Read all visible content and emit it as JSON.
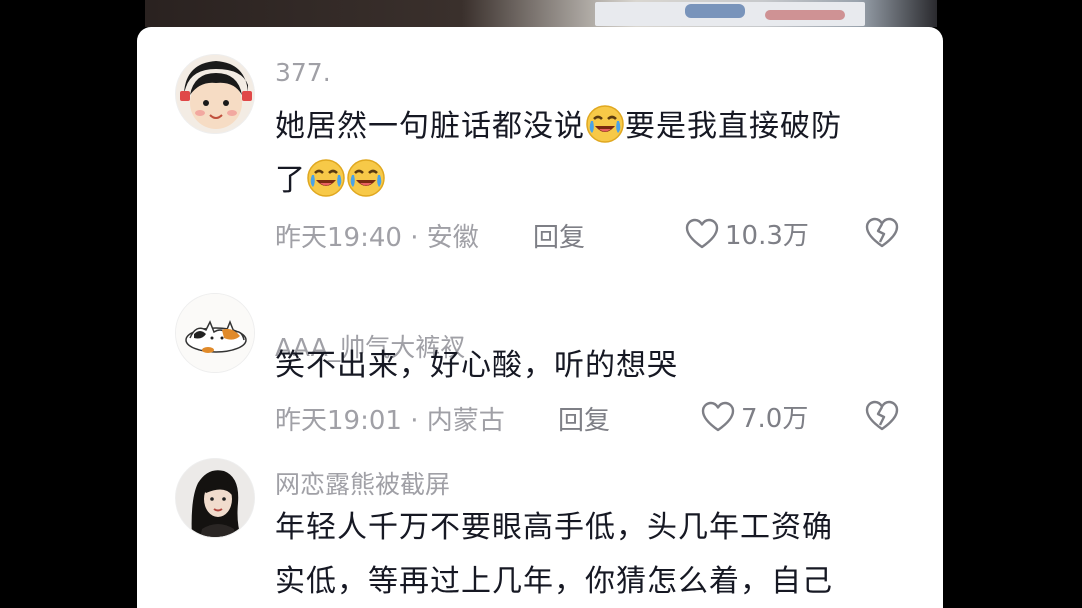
{
  "comments": [
    {
      "username": "377.",
      "text_parts": [
        "她居然一句脏话都没说",
        "要是我直接破防",
        "了"
      ],
      "emoji": "crying-laughing-emoji",
      "time": "昨天19:40",
      "separator": "·",
      "location": "安徽",
      "reply_label": "回复",
      "likes": "10.3万"
    },
    {
      "username": "AAA_帅气大裤衩",
      "text": "笑不出来，好心酸，听的想哭",
      "time": "昨天19:01",
      "separator": "·",
      "location": "内蒙古",
      "reply_label": "回复",
      "likes": "7.0万"
    },
    {
      "username": "网恋露熊被截屏",
      "text_lines": [
        "年轻人千万不要眼高手低，头几年工资确",
        "实低，等再过上几年，你猜怎么着，自己"
      ]
    }
  ],
  "colors": {
    "text": "#161823",
    "meta": "#a0a0a6",
    "action": "#7e7f86",
    "background": "#ffffff"
  },
  "icons": {
    "like": "heart-outline-icon",
    "dislike": "broken-heart-icon"
  }
}
